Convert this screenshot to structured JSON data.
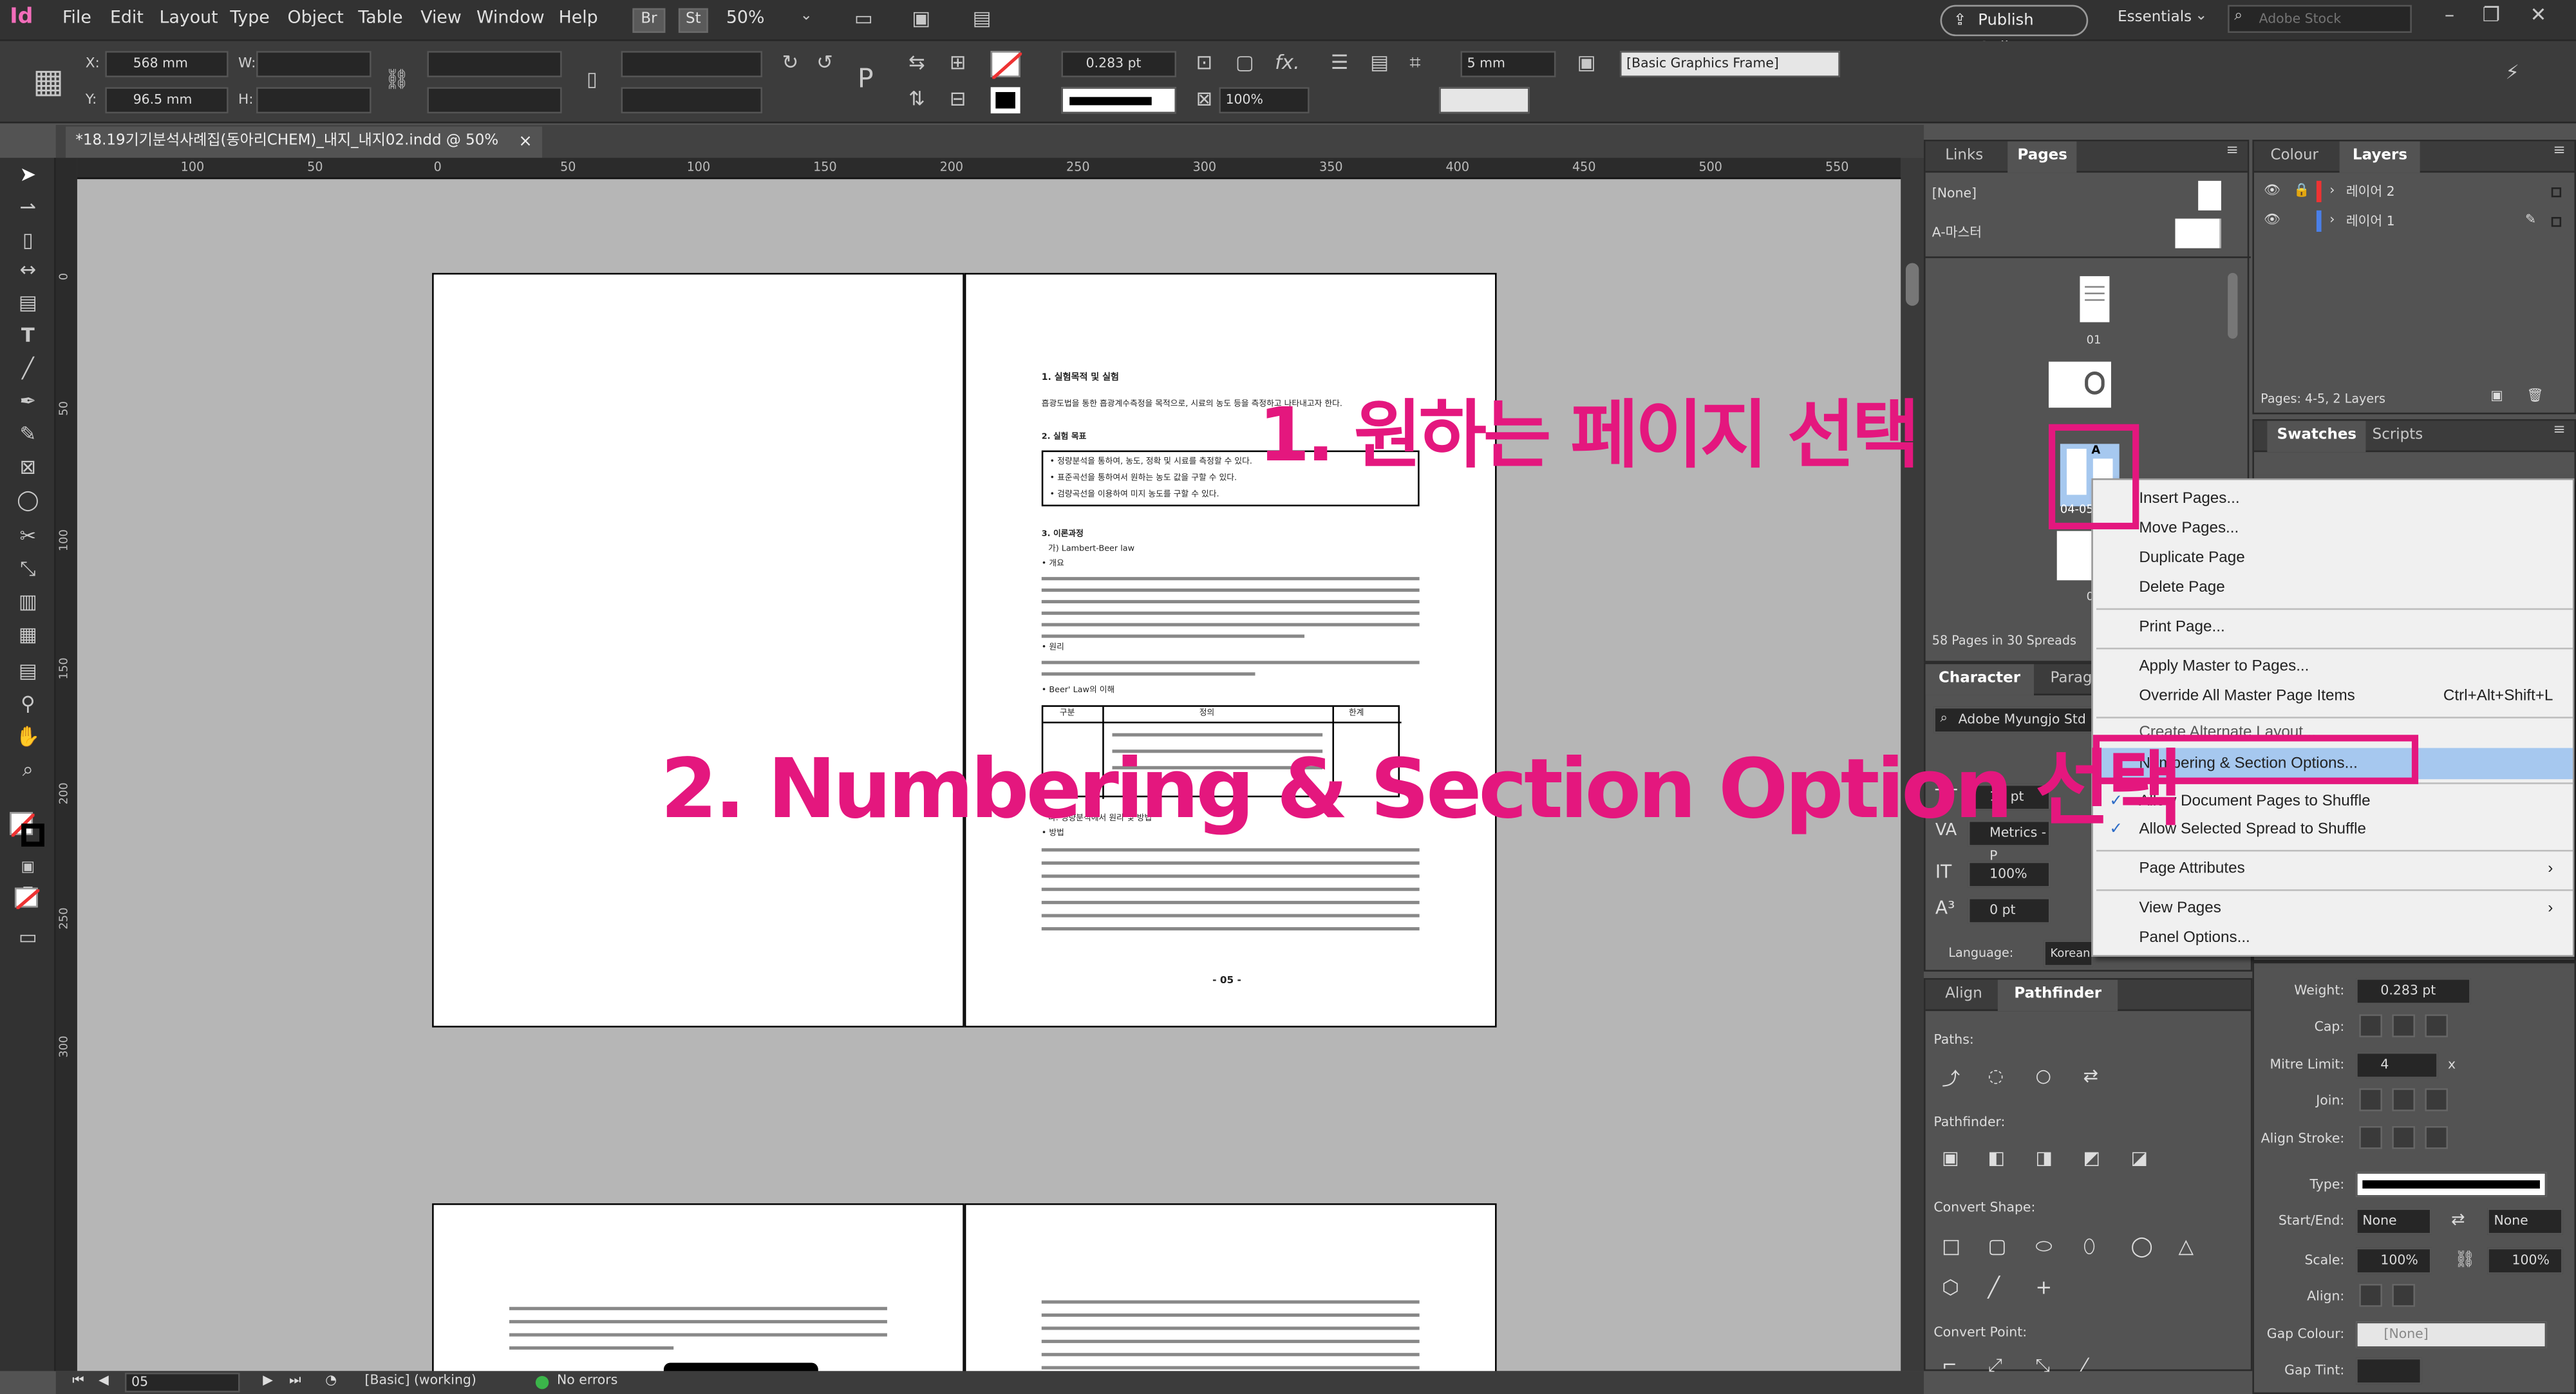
{
  "app": {
    "logo": "Id",
    "zoom": "50%",
    "publish": "Publish Online",
    "workspace": "Essentials",
    "search_placeholder": "Adobe Stock",
    "menus": [
      "File",
      "Edit",
      "Layout",
      "Type",
      "Object",
      "Table",
      "View",
      "Window",
      "Help"
    ],
    "chips": [
      "Br",
      "St"
    ]
  },
  "control": {
    "x": "568 mm",
    "y": "96.5 mm",
    "x_label": "X:",
    "y_label": "Y:",
    "w_label": "W:",
    "h_label": "H:",
    "stroke": "0.283 pt",
    "scale": "100%",
    "gap": "5 mm",
    "style": "[Basic Graphics Frame]"
  },
  "document": {
    "tab": "*18.19기기분석사례집(동아리CHEM)_내지_내지02.indd @ 50%",
    "close": "×",
    "page_number": "- 05 -",
    "ruler_h": [
      "100",
      "50",
      "0",
      "50",
      "100",
      "150",
      "200",
      "250",
      "300",
      "350",
      "400",
      "450",
      "500",
      "550"
    ],
    "ruler_v": [
      "0",
      "50",
      "100",
      "150",
      "200",
      "250",
      "300"
    ]
  },
  "status": {
    "page": "05",
    "master": "[Basic] (working)",
    "errors": "No errors"
  },
  "pages_panel": {
    "tabs": [
      "Links",
      "Pages"
    ],
    "none": "[None]",
    "master": "A-마스터",
    "thumb_labels": [
      "01",
      "04-05",
      "06-07"
    ],
    "master_marker": "A",
    "footer": "58 Pages in 30 Spreads"
  },
  "layers_panel": {
    "tabs": [
      "Colour",
      "Layers"
    ],
    "layers": [
      "레이어 2",
      "레이어 1"
    ],
    "footer": "Pages: 4-5, 2 Layers"
  },
  "swatches_panel": {
    "tabs": [
      "Swatches",
      "Scripts"
    ]
  },
  "character_panel": {
    "tabs": [
      "Character",
      "Parag"
    ],
    "font": "Adobe Myungjo Std",
    "size": "12 pt",
    "kerning": "Metrics - P",
    "vscale": "100%",
    "baseline": "0 pt",
    "lang_label": "Language:",
    "lang": "Korean"
  },
  "pathfinder_panel": {
    "tabs": [
      "Align",
      "Pathfinder"
    ],
    "paths": "Paths:",
    "pathfinder": "Pathfinder:",
    "convert_shape": "Convert Shape:",
    "convert_point": "Convert Point:"
  },
  "stroke_panel": {
    "weight_label": "Weight:",
    "weight": "0.283 pt",
    "cap": "Cap:",
    "mitre": "Mitre Limit:",
    "mitre_val": "4",
    "mitre_x": "x",
    "join": "Join:",
    "align": "Align Stroke:",
    "type": "Type:",
    "startend": "Start/End:",
    "start": "None",
    "end": "None",
    "scale": "Scale:",
    "scale1": "100%",
    "scale2": "100%",
    "align2": "Align:",
    "gapcolour": "Gap Colour:",
    "gapcolour_val": "[None]",
    "gaptint": "Gap Tint:"
  },
  "context_menu": {
    "items": [
      "Insert Pages...",
      "Move Pages...",
      "Duplicate Page",
      "Delete Page",
      "Print Page...",
      "Apply Master to Pages...",
      "Override All Master Page Items",
      "Create Alternate Layout...",
      "Numbering & Section Options...",
      "Allow Document Pages to Shuffle",
      "Allow Selected Spread to Shuffle",
      "Page Attributes",
      "View Pages",
      "Panel Options..."
    ],
    "shortcut": "Ctrl+Alt+Shift+L"
  },
  "annotations": {
    "step1": "1. 원하는 페이지 선택",
    "step2": "2. Numbering & Section Option 선택"
  },
  "colors": {
    "accent": "#e4177e",
    "menu_highlight": "#a6c8ef"
  },
  "doc_text": {
    "h1": "1. 실험목적 및 실험",
    "p1": "흡광도법을 통한 흡광계수측정을 목적으로, 시료의 농도 등을 측정하고 나타내고자 한다.",
    "h2": "2. 실험 목표",
    "b1": "• 정량분석을 통하여, 농도, 정확 및 시료를 측정할 수 있다.",
    "b2": "• 표준곡선을 통하여서 원하는 농도 값을 구할 수 있다.",
    "b3": "• 검량곡선을 이용하여 미지 농도를 구할 수 있다.",
    "h3": "3. 이론과정",
    "s1": "가) Lambert-Beer law",
    "t1": "• 개요",
    "t2": "• 원리",
    "t3": "• Beer' Law의 이해",
    "table_h": [
      "구분",
      "정의",
      "한계"
    ],
    "h4": "나. 정량분석에서 원리 및 방법",
    "t4": "• 방법"
  }
}
